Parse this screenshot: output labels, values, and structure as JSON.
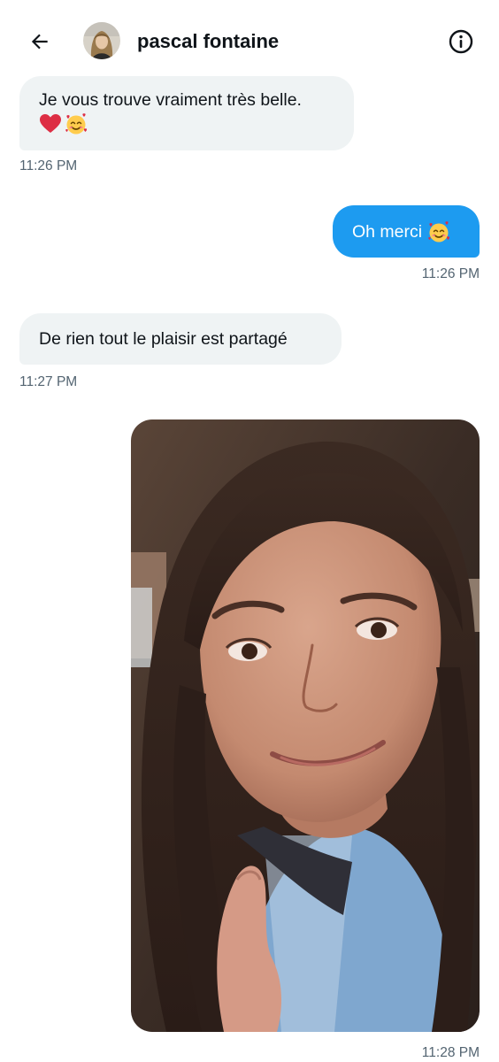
{
  "header": {
    "contact_name": "pascal fontaine",
    "back_icon": "arrow-left-icon",
    "info_icon": "info-circle-icon"
  },
  "conversation": [
    {
      "direction": "incoming",
      "text": "Je vous trouve vraiment très belle.",
      "emojis": [
        "red-heart-emoji",
        "smiling-face-with-hearts-emoji"
      ],
      "time": "11:26 PM"
    },
    {
      "direction": "outgoing",
      "text": "Oh merci",
      "emojis": [
        "smiling-face-with-hearts-emoji"
      ],
      "time": "11:26 PM"
    },
    {
      "direction": "incoming",
      "text": "De rien tout le plaisir est partagé",
      "time": "11:27 PM"
    },
    {
      "direction": "outgoing",
      "type": "photo",
      "photo": "selfie-photo",
      "time": "11:28 PM"
    }
  ],
  "colors": {
    "outgoing_bubble": "#1d9bf0",
    "incoming_bubble": "#eff3f4",
    "timestamp": "#536471",
    "text": "#0f1419"
  }
}
